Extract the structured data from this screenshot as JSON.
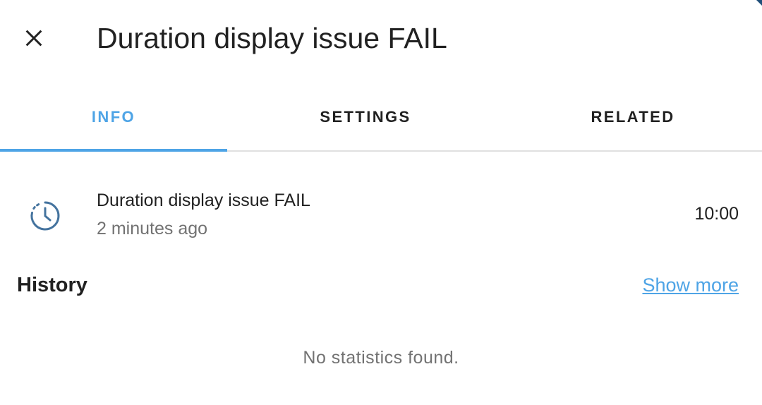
{
  "header": {
    "title": "Duration display issue FAIL",
    "close_icon": "close-icon"
  },
  "tabs": [
    {
      "label": "INFO",
      "active": true
    },
    {
      "label": "SETTINGS",
      "active": false
    },
    {
      "label": "RELATED",
      "active": false
    }
  ],
  "entity": {
    "icon": "timer-outline-icon",
    "name": "Duration display issue FAIL",
    "last_changed": "2 minutes ago",
    "state": "10:00"
  },
  "history": {
    "title": "History",
    "show_more_label": "Show more",
    "empty_message": "No statistics found."
  },
  "colors": {
    "accent": "#4ea4e6",
    "icon": "#44739e",
    "secondary_text": "#727272",
    "primary_text": "#212121",
    "divider": "#e0e0e0"
  }
}
